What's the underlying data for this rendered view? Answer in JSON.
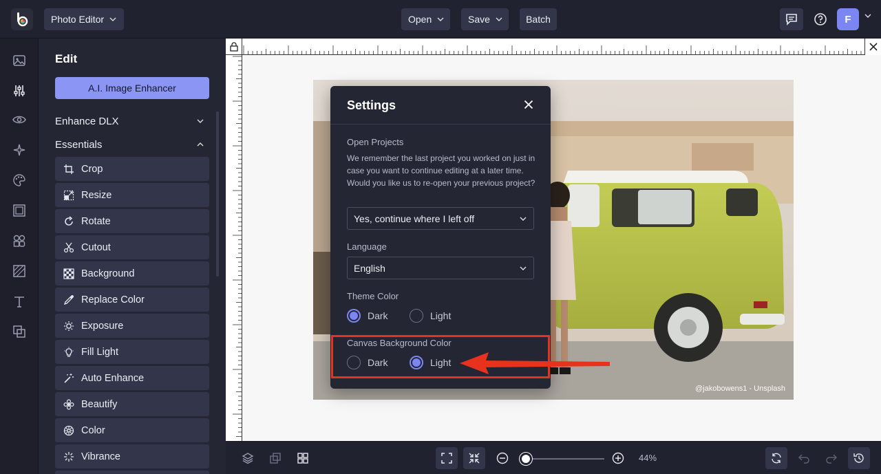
{
  "app": {
    "product_menu_label": "Photo Editor",
    "logo_icon": "befunky-logo-icon",
    "avatar_initial": "F"
  },
  "topbar": {
    "open_label": "Open",
    "save_label": "Save",
    "batch_label": "Batch",
    "icons": [
      "feedback-icon",
      "help-icon",
      "chevron-down-icon"
    ]
  },
  "rail": {
    "icons": [
      "image-icon",
      "sliders-icon",
      "eye-icon",
      "sparkle-icon",
      "palette-icon",
      "frame-icon",
      "shapes-icon",
      "texture-icon",
      "text-icon",
      "overlay-icon"
    ]
  },
  "panel": {
    "title": "Edit",
    "ai_button": "A.I. Image Enhancer",
    "sections": [
      {
        "label": "Enhance DLX",
        "expanded": false
      },
      {
        "label": "Essentials",
        "expanded": true
      }
    ],
    "tools": [
      {
        "label": "Crop",
        "icon": "crop-icon"
      },
      {
        "label": "Resize",
        "icon": "resize-icon"
      },
      {
        "label": "Rotate",
        "icon": "rotate-icon"
      },
      {
        "label": "Cutout",
        "icon": "scissors-icon"
      },
      {
        "label": "Background",
        "icon": "checkerboard-icon"
      },
      {
        "label": "Replace Color",
        "icon": "eyedropper-icon"
      },
      {
        "label": "Exposure",
        "icon": "sun-icon"
      },
      {
        "label": "Fill Light",
        "icon": "bulb-icon"
      },
      {
        "label": "Auto Enhance",
        "icon": "magic-wand-icon"
      },
      {
        "label": "Beautify",
        "icon": "flower-icon"
      },
      {
        "label": "Color",
        "icon": "color-wheel-icon"
      },
      {
        "label": "Vibrance",
        "icon": "burst-icon"
      }
    ]
  },
  "canvas": {
    "photo_credit": "@jakobowens1 - Unsplash",
    "background": "#f7f7f8"
  },
  "settings": {
    "title": "Settings",
    "open_projects": {
      "label": "Open Projects",
      "description": "We remember the last project you worked on just in case you want to continue editing at a later time. Would you like us to re-open your previous project?",
      "selected": "Yes, continue where I left off"
    },
    "language": {
      "label": "Language",
      "selected": "English"
    },
    "theme_color": {
      "label": "Theme Color",
      "options": [
        "Dark",
        "Light"
      ],
      "selected": "Dark"
    },
    "canvas_background_color": {
      "label": "Canvas Background Color",
      "options": [
        "Dark",
        "Light"
      ],
      "selected": "Light"
    }
  },
  "bottombar": {
    "zoom_value": "44%",
    "zoom_fraction": 0.0,
    "icons": [
      "layers-icon",
      "duplicate-icon",
      "grid-icon",
      "fit-screen-icon",
      "actual-size-icon",
      "zoom-out-icon",
      "zoom-in-icon",
      "sync-icon",
      "undo-icon",
      "redo-icon",
      "history-icon"
    ]
  },
  "colors": {
    "accent": "#7b86f2",
    "annotation": "#e8321e",
    "panel_bg": "#252634",
    "tool_bg": "#33354a"
  }
}
